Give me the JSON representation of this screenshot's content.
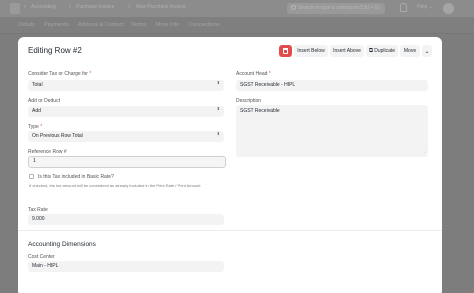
{
  "navbar": {
    "breadcrumbs": [
      "Accounting",
      "Purchase Invoice",
      "New Purchase Invoice"
    ],
    "breadcrumb_sep": "›",
    "search_placeholder": "Search or type a command (Ctrl + G)",
    "help_label": "Help",
    "help_caret": "⌄"
  },
  "tabs": [
    "Details",
    "Payments",
    "Address & Contact",
    "Terms",
    "More Info",
    "Connections"
  ],
  "dialog": {
    "title": "Editing Row #2",
    "buttons": {
      "insert_below": "Insert Below",
      "insert_above": "Insert Above",
      "duplicate": "Duplicate",
      "duplicate_icon": "⧉",
      "move": "Move",
      "collapse_icon": "⌄"
    }
  },
  "form": {
    "consider_tax_label": "Consider Tax or Charge for",
    "consider_tax_value": "Total",
    "add_deduct_label": "Add or Deduct",
    "add_deduct_value": "Add",
    "type_label": "Type",
    "type_value": "On Previous Row Total",
    "reference_row_label": "Reference Row #",
    "reference_row_value": "1",
    "included_label": "Is this Tax included in Basic Rate?",
    "included_help": "If checked, the tax amount will be considered as already included in the Print Rate / Print Amount",
    "tax_rate_label": "Tax Rate",
    "tax_rate_value": "9.000",
    "account_head_label": "Account Head",
    "account_head_value": "SGST Receivable - HIPL",
    "description_label": "Description",
    "description_value": "SGST Receivable",
    "required_mark": "*",
    "select_caret": "⬍",
    "resize_glyph": "⋰"
  },
  "accounting_dimensions": {
    "title": "Accounting Dimensions",
    "cost_center_label": "Cost Center",
    "cost_center_value": "Main - HIPL"
  }
}
